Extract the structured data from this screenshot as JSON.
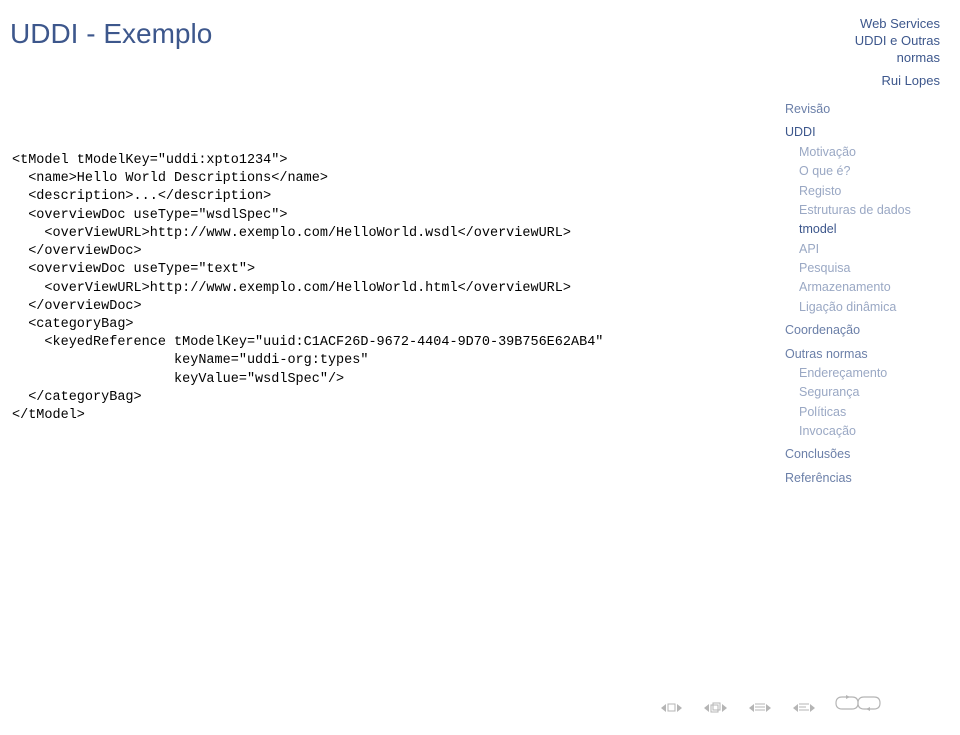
{
  "title": "UDDI - Exemplo",
  "header": {
    "line1": "Web Services",
    "line2": "UDDI e Outras",
    "line3": "normas",
    "author": "Rui Lopes"
  },
  "sidebar": {
    "revisao": "Revisão",
    "uddi": "UDDI",
    "motivacao": "Motivação",
    "oquee": "O que é?",
    "registo": "Registo",
    "estruturas": "Estruturas de dados",
    "tmodel": "tmodel",
    "api": "API",
    "pesquisa": "Pesquisa",
    "armazenamento": "Armazenamento",
    "ligacao": "Ligação dinâmica",
    "coordenacao": "Coordenação",
    "outras": "Outras normas",
    "enderecamento": "Endereçamento",
    "seguranca": "Segurança",
    "politicas": "Políticas",
    "invocacao": "Invocação",
    "conclusoes": "Conclusões",
    "referencias": "Referências"
  },
  "code": {
    "l0": "<tModel tModelKey=\"uddi:xpto1234\">",
    "l1": "  <name>Hello World Descriptions</name>",
    "l2": "  <description>...</description>",
    "l3": "  <overviewDoc useType=\"wsdlSpec\">",
    "l4": "    <overViewURL>http://www.exemplo.com/HelloWorld.wsdl</overviewURL>",
    "l5": "  </overviewDoc>",
    "l6": "  <overviewDoc useType=\"text\">",
    "l7": "    <overViewURL>http://www.exemplo.com/HelloWorld.html</overviewURL>",
    "l8": "  </overviewDoc>",
    "l9": "  <categoryBag>",
    "l10": "    <keyedReference tModelKey=\"uuid:C1ACF26D-9672-4404-9D70-39B756E62AB4\"",
    "l11": "                    keyName=\"uddi-org:types\"",
    "l12": "                    keyValue=\"wsdlSpec\"/>",
    "l13": "  </categoryBag>",
    "l14": "</tModel>"
  }
}
